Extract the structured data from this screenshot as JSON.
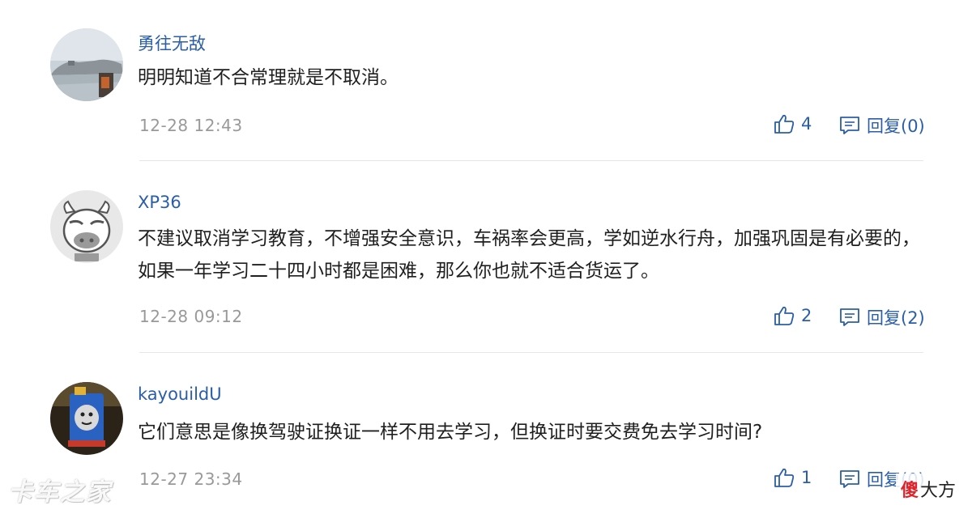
{
  "comments": [
    {
      "username": "勇往无敌",
      "text": "明明知道不合常理就是不取消。",
      "time": "12-28 12:43",
      "likes": "4",
      "reply_label": "回复(0)",
      "avatar_icon": "landscape-photo-icon"
    },
    {
      "username": "XP36",
      "text": "不建议取消学习教育，不增强安全意识，车祸率会更高，学如逆水行舟，加强巩固是有必要的，如果一年学习二十四小时都是困难，那么你也就不适合货运了。",
      "time": "12-28 09:12",
      "likes": "2",
      "reply_label": "回复(2)",
      "avatar_icon": "cow-cartoon-icon"
    },
    {
      "username": "kayouildU",
      "text": "它们意思是像换驾驶证换证一样不用去学习，但换证时要交费免去学习时间?",
      "time": "12-27 23:34",
      "likes": "1",
      "reply_label": "回复(0)",
      "avatar_icon": "toy-train-photo-icon"
    }
  ],
  "watermarks": {
    "left": "卡车之家",
    "right_mark": "傻",
    "right_text": "大方"
  },
  "colors": {
    "link": "#2a5ea8",
    "meta": "#999999",
    "text": "#1f1f1f",
    "divider": "#e6e6e6"
  }
}
